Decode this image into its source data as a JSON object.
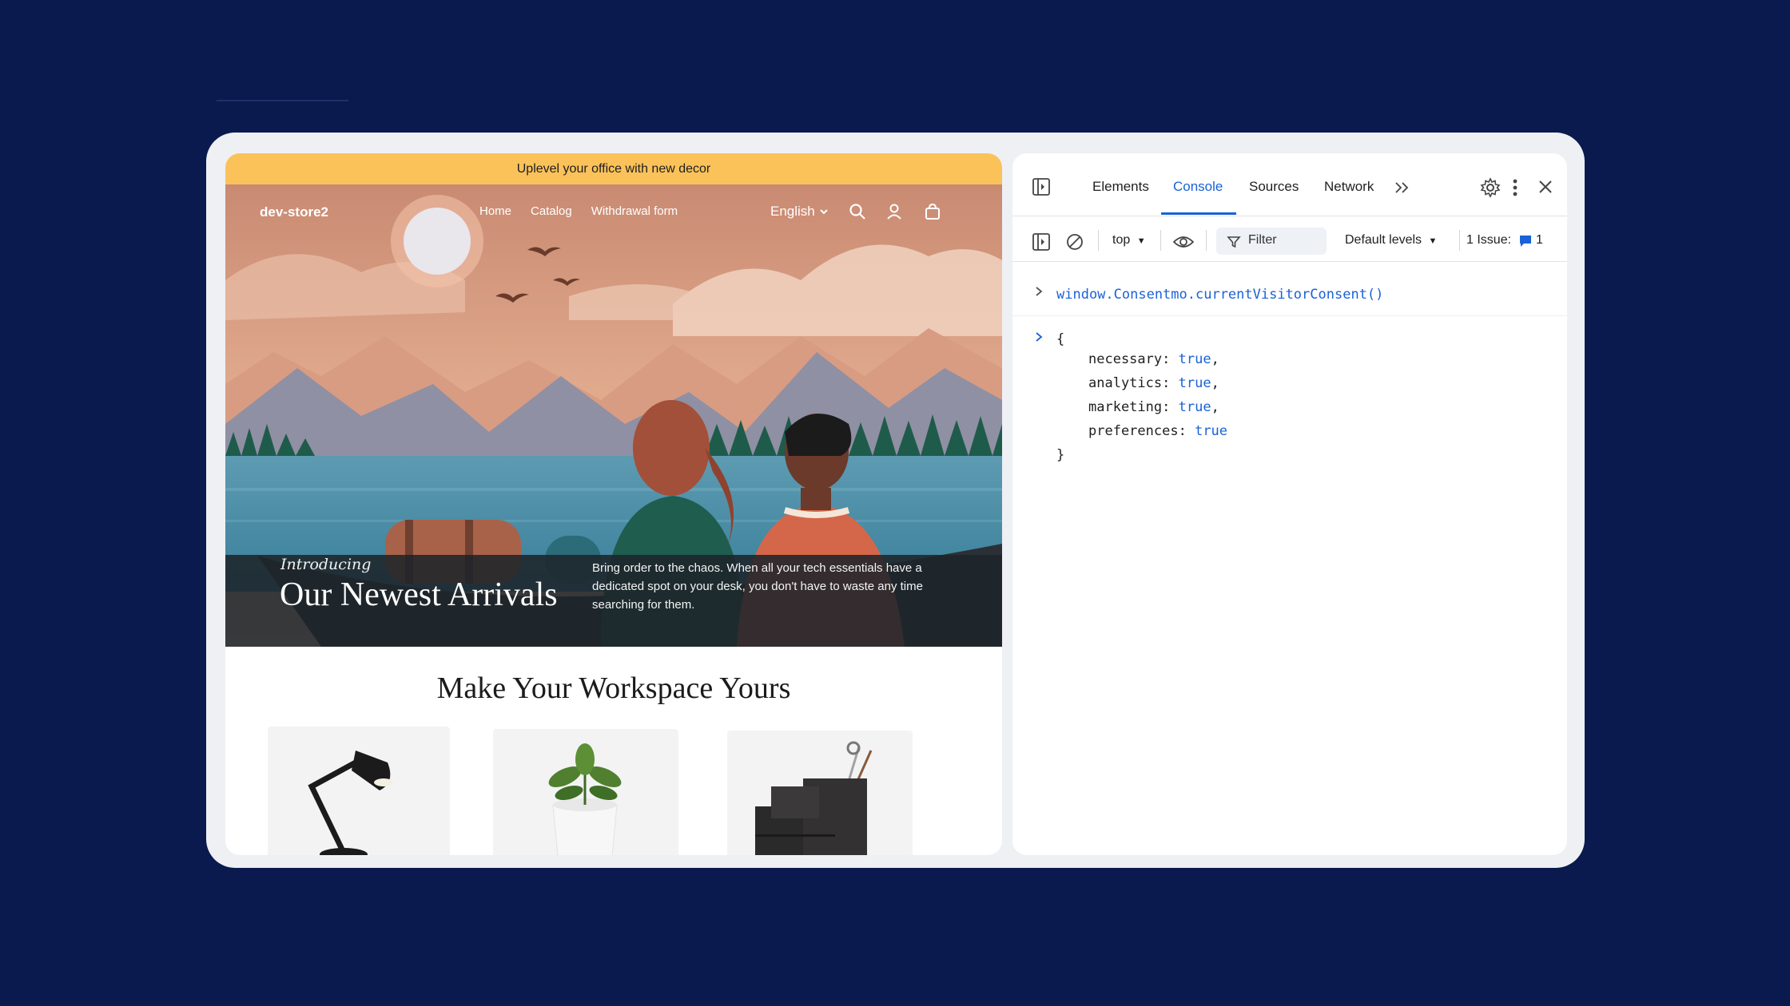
{
  "store": {
    "announcement": "Uplevel your office with new decor",
    "logo": "dev-store2",
    "nav_links": [
      "Home",
      "Catalog",
      "Withdrawal form"
    ],
    "language": "English",
    "hero": {
      "eyebrow": "Introducing",
      "headline": "Our Newest Arrivals",
      "blurb": "Bring order to the chaos. When all your tech essentials have a dedicated spot on your desk, you don't have to waste any time searching for them."
    },
    "section_title": "Make Your Workspace Yours",
    "products": [
      "desk-lamp",
      "potted-plant",
      "desk-organizer"
    ]
  },
  "devtools": {
    "tabs": [
      "Elements",
      "Console",
      "Sources",
      "Network"
    ],
    "active_tab": "Console",
    "toolbar": {
      "context": "top",
      "filter_placeholder": "Filter",
      "levels": "Default levels",
      "issues_label": "1 Issue:",
      "issues_count": "1"
    },
    "console": {
      "input": "window.Consentmo.currentVisitorConsent()",
      "open_brace": "{",
      "close_brace": "}",
      "entries": [
        {
          "key": "necessary:",
          "value": "true",
          "trail": ","
        },
        {
          "key": "analytics:",
          "value": "true",
          "trail": ","
        },
        {
          "key": "marketing:",
          "value": "true",
          "trail": ","
        },
        {
          "key": "preferences:",
          "value": "true",
          "trail": ""
        }
      ]
    },
    "accent_color": "#1a62d6"
  }
}
